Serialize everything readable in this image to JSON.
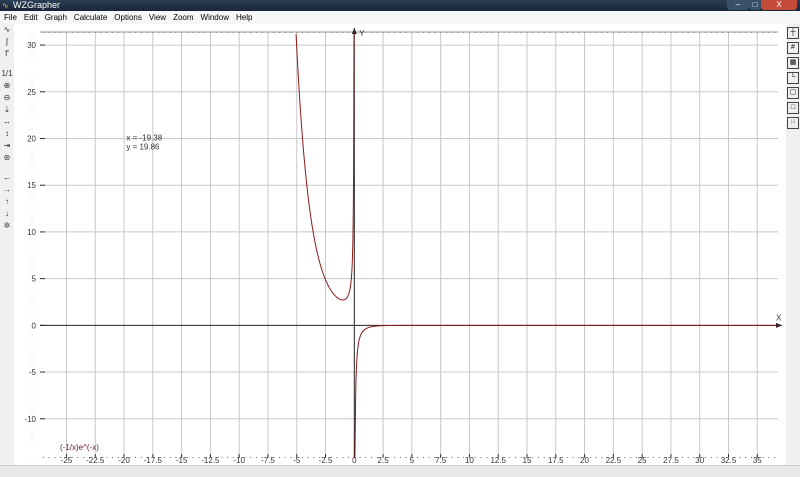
{
  "window": {
    "title": "WZGrapher",
    "minimize": "–",
    "maximize": "□",
    "close": "X"
  },
  "menu": [
    "File",
    "Edit",
    "Graph",
    "Calculate",
    "Options",
    "View",
    "Zoom",
    "Window",
    "Help"
  ],
  "left_toolbar": [
    {
      "icon": "function-icon",
      "glyph": "∿"
    },
    {
      "icon": "integral-icon",
      "glyph": "∫"
    },
    {
      "icon": "derivative-icon",
      "glyph": "f'"
    },
    {
      "icon": "zoom-ratio-label",
      "glyph": "1/1"
    },
    {
      "icon": "zoom-in-icon",
      "glyph": "⊕"
    },
    {
      "icon": "zoom-out-icon",
      "glyph": "⊖"
    },
    {
      "icon": "shrink-vertical-icon",
      "glyph": "⇣"
    },
    {
      "icon": "expand-horizontal-icon",
      "glyph": "↔"
    },
    {
      "icon": "expand-vertical-icon",
      "glyph": "↕"
    },
    {
      "icon": "shrink-horizontal-icon",
      "glyph": "⇥"
    },
    {
      "icon": "zoom-fit-icon",
      "glyph": "⊛"
    },
    {
      "icon": "pan-left-icon",
      "glyph": "←"
    },
    {
      "icon": "pan-right-icon",
      "glyph": "→"
    },
    {
      "icon": "pan-up-icon",
      "glyph": "↑"
    },
    {
      "icon": "pan-down-icon",
      "glyph": "↓"
    },
    {
      "icon": "reset-view-icon",
      "glyph": "✲"
    }
  ],
  "right_toolbar": [
    {
      "icon": "axes-icon",
      "glyph": "┼"
    },
    {
      "icon": "grid-icon",
      "glyph": "#"
    },
    {
      "icon": "fine-grid-icon",
      "glyph": "▦"
    },
    {
      "icon": "frame-axes-icon",
      "glyph": "└"
    },
    {
      "icon": "box-icon",
      "glyph": "▢"
    },
    {
      "icon": "square-icon",
      "glyph": "□"
    },
    {
      "icon": "dotted-grid-icon",
      "glyph": "⁙"
    }
  ],
  "cursor_readout": {
    "x": "x = -19.38",
    "y": "y = 19.86"
  },
  "chart_data": {
    "type": "line",
    "function": "(-1/x)e^(-x)",
    "legend_label": "(-1/x)e^(-x)",
    "color": "#8b1a1a",
    "xlabel": "X",
    "ylabel": "Y",
    "xlim": [
      -27.3,
      36.8
    ],
    "ylim": [
      -14.2,
      31.4
    ],
    "x_ticks": [
      -25,
      -22.5,
      -20,
      -17.5,
      -15,
      -12.5,
      -10,
      -7.5,
      -5,
      -2.5,
      0,
      2.5,
      5,
      7.5,
      10,
      12.5,
      15,
      17.5,
      20,
      22.5,
      25,
      27.5,
      30,
      32.5,
      35
    ],
    "y_ticks": [
      -10,
      -5,
      0,
      5,
      10,
      15,
      20,
      25,
      30
    ],
    "x_tick_labels": [
      "-25",
      "-22.5",
      "-20",
      "-17.5",
      "-15",
      "-12.5",
      "-10",
      "-7.5",
      "-5",
      "-2.5",
      "0",
      "2.5",
      "5",
      "7.5",
      "10",
      "12.5",
      "15",
      "17.5",
      "20",
      "22.5",
      "25",
      "27.5",
      "30",
      "32.5",
      "35"
    ],
    "y_tick_labels": [
      "-10",
      "-5",
      "0",
      "5",
      "10",
      "15",
      "20",
      "25",
      "30"
    ],
    "grid": true
  }
}
